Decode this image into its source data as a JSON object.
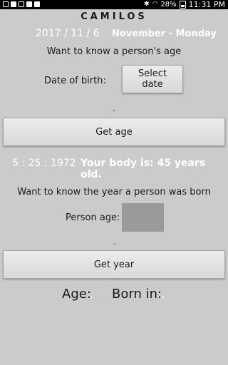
{
  "status_bar": {
    "battery": "28%",
    "time": "11:31 PM"
  },
  "app": {
    "title": "CAMILOS"
  },
  "current_date": {
    "numeric": "2017 / 11 / 6",
    "month_day": "November - Monday"
  },
  "age_section": {
    "question": "Want to know a person's age",
    "dob_label": "Date of birth:",
    "select_date_label": "Select date",
    "get_age_label": "Get age",
    "result_date": "5 : 25 : 1972",
    "result_text": "Your body is: 45 years old."
  },
  "year_section": {
    "question": "Want to know the year a person was born",
    "age_label": "Person age:",
    "age_value": "",
    "get_year_label": "Get year"
  },
  "summary": {
    "age_label": "Age:",
    "age_value": ".",
    "born_label": "Born in:",
    "born_value": "."
  },
  "colors": {
    "background": "#cbcbcb",
    "highlight_text": "#ffffff",
    "input_fill": "#9a9a9a",
    "dot": "#d63a5a"
  }
}
